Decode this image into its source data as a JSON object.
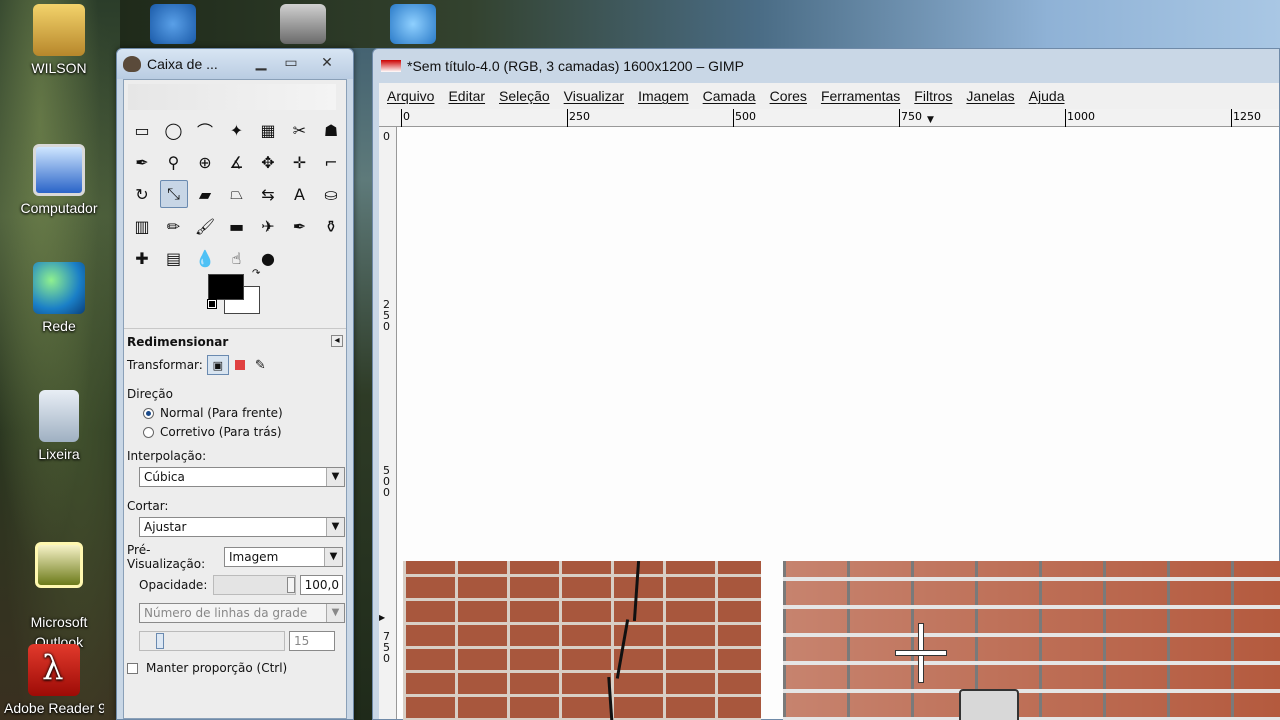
{
  "desktop": {
    "icons": [
      {
        "label": "WILSON",
        "icon": "user-folder-icon"
      },
      {
        "label": "Computador",
        "icon": "computer-icon"
      },
      {
        "label": "Rede",
        "icon": "network-icon"
      },
      {
        "label": "Lixeira",
        "icon": "recycle-bin-icon"
      },
      {
        "label": "Microsoft\nOutlook",
        "icon": "outlook-icon"
      },
      {
        "label": "Adobe Reader 9",
        "icon": "adobe-reader-icon"
      }
    ]
  },
  "toolbox": {
    "title": "Caixa de ...",
    "tools": [
      "rect-select-icon",
      "ellipse-select-icon",
      "free-select-icon",
      "fuzzy-select-icon",
      "color-select-icon",
      "scissors-icon",
      "foreground-select-icon",
      "paths-icon",
      "color-picker-icon",
      "zoom-icon",
      "measure-icon",
      "move-icon",
      "align-icon",
      "crop-icon",
      "rotate-icon",
      "scale-icon",
      "shear-icon",
      "perspective-icon",
      "flip-icon",
      "text-icon",
      "bucket-fill-icon",
      "blend-icon",
      "pencil-icon",
      "paintbrush-icon",
      "eraser-icon",
      "airbrush-icon",
      "ink-icon",
      "clone-icon",
      "heal-icon",
      "perspective-clone-icon",
      "blur-icon",
      "smudge-icon",
      "dodge-burn-icon"
    ],
    "active_tool": "scale-icon",
    "fg_color": "#000000",
    "bg_color": "#ffffff",
    "options": {
      "header": "Redimensionar",
      "transform_label": "Transformar:",
      "direction_label": "Direção",
      "direction_normal": "Normal (Para frente)",
      "direction_corrective": "Corretivo (Para trás)",
      "interpolation_label": "Interpolação:",
      "interpolation_value": "Cúbica",
      "clipping_label": "Cortar:",
      "clipping_value": "Ajustar",
      "preview_label": "Pré-Visualização:",
      "preview_value": "Imagem",
      "opacity_label": "Opacidade:",
      "opacity_value": "100,0",
      "grid_lines_value": "Número de linhas da grade",
      "grid_count_value": "15",
      "keep_aspect_label": "Manter proporção (Ctrl)"
    }
  },
  "image_window": {
    "title": "*Sem título-4.0 (RGB, 3 camadas) 1600x1200 – GIMP",
    "menu": [
      "Arquivo",
      "Editar",
      "Seleção",
      "Visualizar",
      "Imagem",
      "Camada",
      "Cores",
      "Ferramentas",
      "Filtros",
      "Janelas",
      "Ajuda"
    ],
    "hruler_labels": [
      "0",
      "250",
      "500",
      "750",
      "1000",
      "1250"
    ],
    "vruler_labels": [
      "0",
      "250",
      "500",
      "750"
    ]
  }
}
